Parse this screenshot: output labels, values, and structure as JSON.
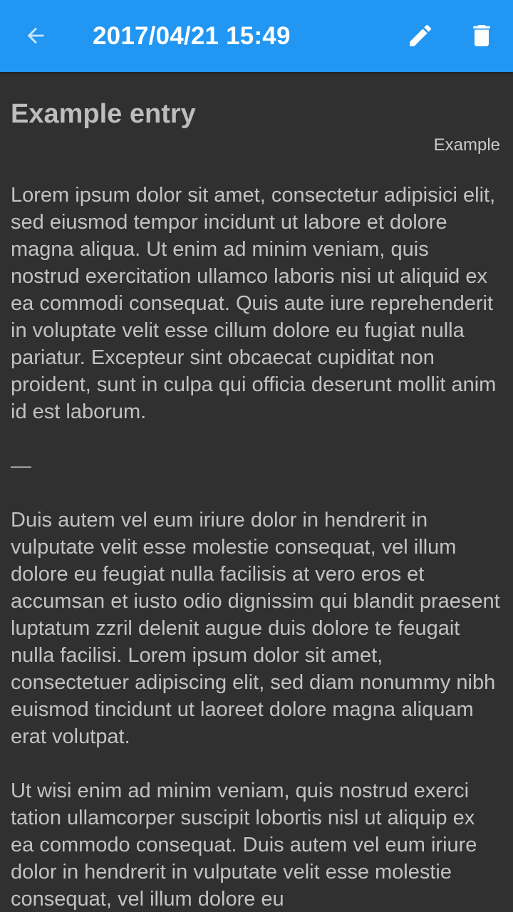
{
  "appbar": {
    "title": "2017/04/21 15:49",
    "color": "#2196F3",
    "back_icon": "arrow-left-icon",
    "edit_icon": "pencil-icon",
    "delete_icon": "trash-icon"
  },
  "entry": {
    "title": "Example entry",
    "tag": "Example",
    "paragraphs": [
      "Lorem ipsum dolor sit amet, consectetur adipis­ici elit, sed eiusmod tempor incidunt ut labore et dolore magna aliqua. Ut enim ad minim veniam, quis nostrud exercitation ullamco laboris nisi ut aliquid ex ea commodi consequat. Quis aute iure reprehenderit in voluptate velit esse cillum dolore eu fugiat nulla pariatur. Excepteur sint obcaecat cupiditat non proident, sunt in culpa qui officia deserunt mollit anim id est laborum.",
      "—",
      "Duis autem vel eum iriure dolor in hendrerit in vulputate velit esse molestie consequat, vel illum dolore eu feugiat nulla facilisis at vero eros et accumsan et iusto odio dignissim qui blandit praesent luptatum zzril delenit augue duis dolore te feugait nulla facilisi. Lorem ipsum dolor sit amet, consectetuer adipiscing elit, sed diam nonummy nibh euismod tincidunt ut laoreet dolore magna aliquam erat volutpat.",
      "Ut wisi enim ad minim veniam, quis nostrud exerci tation ullamcorper suscipit lobortis nisl ut aliquip ex ea commodo consequat. Duis autem vel eum iriure dolor in hendrerit in vulputate velit esse molestie consequat, vel illum dolore eu"
    ]
  }
}
